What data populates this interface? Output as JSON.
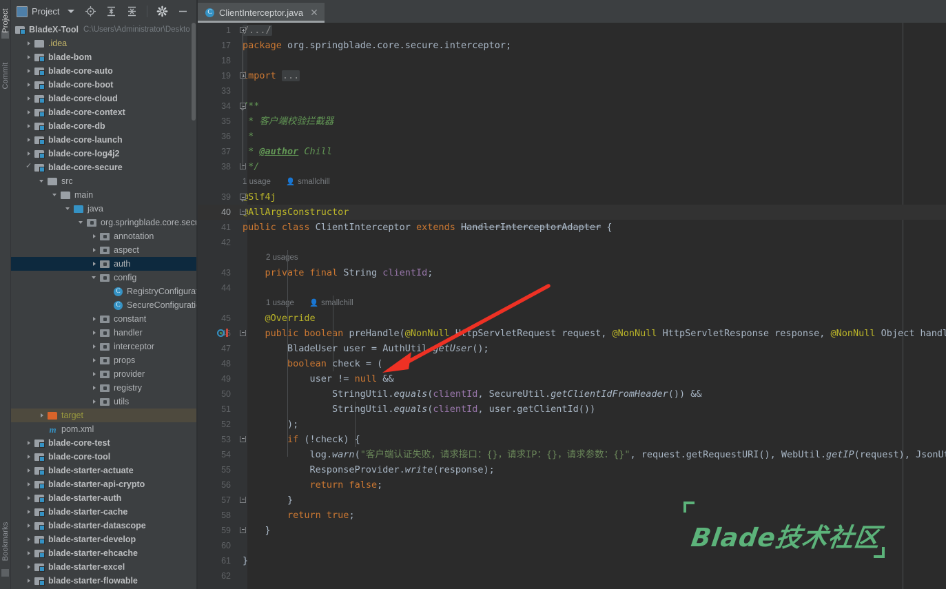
{
  "window": {
    "tool_strip": [
      {
        "label": "Project",
        "name": "tool-tab-project"
      },
      {
        "label": "Commit",
        "name": "tool-tab-commit"
      },
      {
        "label": "Bookmarks",
        "name": "tool-tab-bookmarks"
      }
    ]
  },
  "project_panel": {
    "title": "Project",
    "toolbar": [
      {
        "name": "locate-icon",
        "glyph": "locate"
      },
      {
        "name": "expand-all-icon",
        "glyph": "expand"
      },
      {
        "name": "collapse-all-icon",
        "glyph": "collapse"
      },
      {
        "name": "settings-gear-icon",
        "glyph": "gear"
      },
      {
        "name": "hide-panel-icon",
        "glyph": "minus"
      }
    ],
    "root": {
      "label": "BladeX-Tool",
      "path": "C:\\Users\\Administrator\\Deskto"
    },
    "tree": [
      {
        "label": ".idea",
        "indent": 1,
        "icon": "folder",
        "arrow": "closed",
        "style": "yellowish"
      },
      {
        "label": "blade-bom",
        "indent": 1,
        "icon": "module",
        "arrow": "closed",
        "style": "bold"
      },
      {
        "label": "blade-core-auto",
        "indent": 1,
        "icon": "module",
        "arrow": "closed",
        "style": "bold"
      },
      {
        "label": "blade-core-boot",
        "indent": 1,
        "icon": "module",
        "arrow": "closed",
        "style": "bold"
      },
      {
        "label": "blade-core-cloud",
        "indent": 1,
        "icon": "module",
        "arrow": "closed",
        "style": "bold"
      },
      {
        "label": "blade-core-context",
        "indent": 1,
        "icon": "module",
        "arrow": "closed",
        "style": "bold"
      },
      {
        "label": "blade-core-db",
        "indent": 1,
        "icon": "module",
        "arrow": "closed",
        "style": "bold"
      },
      {
        "label": "blade-core-launch",
        "indent": 1,
        "icon": "module",
        "arrow": "closed",
        "style": "bold"
      },
      {
        "label": "blade-core-log4j2",
        "indent": 1,
        "icon": "module",
        "arrow": "closed",
        "style": "bold"
      },
      {
        "label": "blade-core-secure",
        "indent": 1,
        "icon": "module",
        "arrow": "check",
        "style": "bold"
      },
      {
        "label": "src",
        "indent": 2,
        "icon": "folder",
        "arrow": "open",
        "style": "dim"
      },
      {
        "label": "main",
        "indent": 3,
        "icon": "folder",
        "arrow": "open",
        "style": "dim"
      },
      {
        "label": "java",
        "indent": 4,
        "icon": "folder-blue",
        "arrow": "open",
        "style": "dim"
      },
      {
        "label": "org.springblade.core.secure",
        "indent": 5,
        "icon": "pkg",
        "arrow": "open",
        "style": "dim"
      },
      {
        "label": "annotation",
        "indent": 6,
        "icon": "pkg",
        "arrow": "closed",
        "style": "dim"
      },
      {
        "label": "aspect",
        "indent": 6,
        "icon": "pkg",
        "arrow": "closed",
        "style": "dim"
      },
      {
        "label": "auth",
        "indent": 6,
        "icon": "pkg",
        "arrow": "closed",
        "style": "dim",
        "state": "selected"
      },
      {
        "label": "config",
        "indent": 6,
        "icon": "pkg",
        "arrow": "open",
        "style": "dim"
      },
      {
        "label": "RegistryConfiguration",
        "indent": 7,
        "icon": "class",
        "arrow": "none",
        "style": "dim"
      },
      {
        "label": "SecureConfiguration",
        "indent": 7,
        "icon": "class",
        "arrow": "none",
        "style": "dim"
      },
      {
        "label": "constant",
        "indent": 6,
        "icon": "pkg",
        "arrow": "closed",
        "style": "dim"
      },
      {
        "label": "handler",
        "indent": 6,
        "icon": "pkg",
        "arrow": "closed",
        "style": "dim"
      },
      {
        "label": "interceptor",
        "indent": 6,
        "icon": "pkg",
        "arrow": "closed",
        "style": "dim"
      },
      {
        "label": "props",
        "indent": 6,
        "icon": "pkg",
        "arrow": "closed",
        "style": "dim"
      },
      {
        "label": "provider",
        "indent": 6,
        "icon": "pkg",
        "arrow": "closed",
        "style": "dim"
      },
      {
        "label": "registry",
        "indent": 6,
        "icon": "pkg",
        "arrow": "closed",
        "style": "dim"
      },
      {
        "label": "utils",
        "indent": 6,
        "icon": "pkg",
        "arrow": "closed",
        "style": "dim"
      },
      {
        "label": "target",
        "indent": 2,
        "icon": "folder-orange",
        "arrow": "closed",
        "style": "olive",
        "state": "hovered"
      },
      {
        "label": "pom.xml",
        "indent": 2,
        "icon": "maven",
        "arrow": "none",
        "style": "dim"
      },
      {
        "label": "blade-core-test",
        "indent": 1,
        "icon": "module",
        "arrow": "closed",
        "style": "bold"
      },
      {
        "label": "blade-core-tool",
        "indent": 1,
        "icon": "module",
        "arrow": "closed",
        "style": "bold"
      },
      {
        "label": "blade-starter-actuate",
        "indent": 1,
        "icon": "module",
        "arrow": "closed",
        "style": "bold"
      },
      {
        "label": "blade-starter-api-crypto",
        "indent": 1,
        "icon": "module",
        "arrow": "closed",
        "style": "bold"
      },
      {
        "label": "blade-starter-auth",
        "indent": 1,
        "icon": "module",
        "arrow": "closed",
        "style": "bold"
      },
      {
        "label": "blade-starter-cache",
        "indent": 1,
        "icon": "module",
        "arrow": "closed",
        "style": "bold"
      },
      {
        "label": "blade-starter-datascope",
        "indent": 1,
        "icon": "module",
        "arrow": "closed",
        "style": "bold"
      },
      {
        "label": "blade-starter-develop",
        "indent": 1,
        "icon": "module",
        "arrow": "closed",
        "style": "bold"
      },
      {
        "label": "blade-starter-ehcache",
        "indent": 1,
        "icon": "module",
        "arrow": "closed",
        "style": "bold"
      },
      {
        "label": "blade-starter-excel",
        "indent": 1,
        "icon": "module",
        "arrow": "closed",
        "style": "bold"
      },
      {
        "label": "blade-starter-flowable",
        "indent": 1,
        "icon": "module",
        "arrow": "closed",
        "style": "bold"
      }
    ]
  },
  "editor": {
    "tab": {
      "label": "ClientInterceptor.java",
      "icon": "java-class-icon",
      "close": "✕"
    },
    "current_line": 40,
    "lines": [
      {
        "no": "1",
        "kind": "code",
        "fold": "plus",
        "tokens": [
          {
            "t": "/.../",
            "c": "fold-ph"
          }
        ]
      },
      {
        "no": "17",
        "kind": "code",
        "tokens": [
          {
            "t": "package ",
            "c": "kw"
          },
          {
            "t": "org.springblade.core.secure.interceptor;",
            "c": "id"
          }
        ]
      },
      {
        "no": "18",
        "kind": "code",
        "tokens": []
      },
      {
        "no": "19",
        "kind": "code",
        "fold": "plus",
        "tokens": [
          {
            "t": "import ",
            "c": "kw"
          },
          {
            "t": "...",
            "c": "fold-ph"
          }
        ]
      },
      {
        "no": "33",
        "kind": "code",
        "tokens": []
      },
      {
        "no": "34",
        "kind": "code",
        "fold": "arrowdown",
        "tokens": [
          {
            "t": "/**",
            "c": "cmt"
          }
        ]
      },
      {
        "no": "35",
        "kind": "code",
        "tokens": [
          {
            "t": " * 客户端校验拦截器",
            "c": "cmt"
          }
        ]
      },
      {
        "no": "36",
        "kind": "code",
        "tokens": [
          {
            "t": " *",
            "c": "cmt"
          }
        ]
      },
      {
        "no": "37",
        "kind": "code",
        "tokens": [
          {
            "t": " * ",
            "c": "cmt"
          },
          {
            "t": "@author",
            "c": "cmtl"
          },
          {
            "t": " Chill",
            "c": "cmt"
          }
        ]
      },
      {
        "no": "38",
        "kind": "code",
        "fold": "end",
        "tokens": [
          {
            "t": " */",
            "c": "cmt"
          }
        ]
      },
      {
        "no": "",
        "kind": "hint",
        "usage": "1 usage",
        "author": "smallchill",
        "hint_indent": 0
      },
      {
        "no": "39",
        "kind": "code",
        "fold": "arrowdown",
        "tokens": [
          {
            "t": "@Slf4j",
            "c": "ann"
          }
        ]
      },
      {
        "no": "40",
        "kind": "code",
        "fold": "end",
        "tokens": [
          {
            "t": "@AllArgsConstructor",
            "c": "ann"
          }
        ]
      },
      {
        "no": "41",
        "kind": "code",
        "tokens": [
          {
            "t": "public class ",
            "c": "kw"
          },
          {
            "t": "ClientInterceptor",
            "c": "id"
          },
          {
            "t": " extends ",
            "c": "kw"
          },
          {
            "t": "HandlerInterceptorAdapter",
            "c": "dep"
          },
          {
            "t": " {",
            "c": "id"
          }
        ]
      },
      {
        "no": "42",
        "kind": "code",
        "tokens": []
      },
      {
        "no": "",
        "kind": "hint",
        "usage": "2 usages",
        "author": "",
        "hint_indent": 34
      },
      {
        "no": "43",
        "kind": "code",
        "tokens": [
          {
            "t": "    ",
            "c": "id"
          },
          {
            "t": "private final ",
            "c": "kw"
          },
          {
            "t": "String",
            "c": "id"
          },
          {
            "t": " ",
            "c": "id"
          },
          {
            "t": "clientId",
            "c": "fld"
          },
          {
            "t": ";",
            "c": "id"
          }
        ]
      },
      {
        "no": "44",
        "kind": "code",
        "tokens": []
      },
      {
        "no": "",
        "kind": "hint",
        "usage": "1 usage",
        "author": "smallchill",
        "hint_indent": 34
      },
      {
        "no": "45",
        "kind": "code",
        "tokens": [
          {
            "t": "    ",
            "c": "id"
          },
          {
            "t": "@Override",
            "c": "ann"
          }
        ]
      },
      {
        "no": "46",
        "kind": "code",
        "fold": "end2",
        "gutter_icon": "override-method-icon",
        "tokens": [
          {
            "t": "    ",
            "c": "id"
          },
          {
            "t": "public boolean ",
            "c": "kw"
          },
          {
            "t": "preHandle",
            "c": "id"
          },
          {
            "t": "(",
            "c": "id"
          },
          {
            "t": "@NonNull",
            "c": "ann"
          },
          {
            "t": " HttpServletRequest request, ",
            "c": "id"
          },
          {
            "t": "@NonNull",
            "c": "ann"
          },
          {
            "t": " HttpServletResponse response, ",
            "c": "id"
          },
          {
            "t": "@NonNull",
            "c": "ann"
          },
          {
            "t": " Object handler",
            "c": "id"
          }
        ]
      },
      {
        "no": "47",
        "kind": "code",
        "tokens": [
          {
            "t": "        BladeUser user = AuthUtil.",
            "c": "id"
          },
          {
            "t": "getUser",
            "c": "mth"
          },
          {
            "t": "();",
            "c": "id"
          }
        ]
      },
      {
        "no": "48",
        "kind": "code",
        "tokens": [
          {
            "t": "        ",
            "c": "id"
          },
          {
            "t": "boolean ",
            "c": "kw"
          },
          {
            "t": "check = (",
            "c": "id"
          }
        ]
      },
      {
        "no": "49",
        "kind": "code",
        "tokens": [
          {
            "t": "            user != ",
            "c": "id"
          },
          {
            "t": "null",
            "c": "kw"
          },
          {
            "t": " &&",
            "c": "id"
          }
        ]
      },
      {
        "no": "50",
        "kind": "code",
        "tokens": [
          {
            "t": "                StringUtil.",
            "c": "id"
          },
          {
            "t": "equals",
            "c": "mth"
          },
          {
            "t": "(",
            "c": "id"
          },
          {
            "t": "clientId",
            "c": "fld"
          },
          {
            "t": ", SecureUtil.",
            "c": "id"
          },
          {
            "t": "getClientIdFromHeader",
            "c": "mth"
          },
          {
            "t": "()) &&",
            "c": "id"
          }
        ]
      },
      {
        "no": "51",
        "kind": "code",
        "tokens": [
          {
            "t": "                StringUtil.",
            "c": "id"
          },
          {
            "t": "equals",
            "c": "mth"
          },
          {
            "t": "(",
            "c": "id"
          },
          {
            "t": "clientId",
            "c": "fld"
          },
          {
            "t": ", user.getClientId())",
            "c": "id"
          }
        ]
      },
      {
        "no": "52",
        "kind": "code",
        "tokens": [
          {
            "t": "        );",
            "c": "id"
          }
        ]
      },
      {
        "no": "53",
        "kind": "code",
        "fold": "end3",
        "tokens": [
          {
            "t": "        ",
            "c": "id"
          },
          {
            "t": "if",
            "c": "kw"
          },
          {
            "t": " (!check) {",
            "c": "id"
          }
        ]
      },
      {
        "no": "54",
        "kind": "code",
        "tokens": [
          {
            "t": "            log.",
            "c": "id"
          },
          {
            "t": "warn",
            "c": "mth"
          },
          {
            "t": "(",
            "c": "id"
          },
          {
            "t": "\"客户端认证失败，请求接口：{}，请求IP：{}，请求参数：{}\"",
            "c": "str"
          },
          {
            "t": ", request.getRequestURI(), WebUtil.",
            "c": "id"
          },
          {
            "t": "getIP",
            "c": "mth"
          },
          {
            "t": "(request), JsonUtil",
            "c": "id"
          }
        ]
      },
      {
        "no": "55",
        "kind": "code",
        "tokens": [
          {
            "t": "            ResponseProvider.",
            "c": "id"
          },
          {
            "t": "write",
            "c": "mth"
          },
          {
            "t": "(response);",
            "c": "id"
          }
        ]
      },
      {
        "no": "56",
        "kind": "code",
        "tokens": [
          {
            "t": "            ",
            "c": "id"
          },
          {
            "t": "return false",
            "c": "kw"
          },
          {
            "t": ";",
            "c": "id"
          }
        ]
      },
      {
        "no": "57",
        "kind": "code",
        "fold": "endbrace",
        "tokens": [
          {
            "t": "        }",
            "c": "id"
          }
        ]
      },
      {
        "no": "58",
        "kind": "code",
        "tokens": [
          {
            "t": "        ",
            "c": "id"
          },
          {
            "t": "return true",
            "c": "kw"
          },
          {
            "t": ";",
            "c": "id"
          }
        ]
      },
      {
        "no": "59",
        "kind": "code",
        "fold": "endbrace2",
        "tokens": [
          {
            "t": "    }",
            "c": "id"
          }
        ]
      },
      {
        "no": "60",
        "kind": "code",
        "tokens": []
      },
      {
        "no": "61",
        "kind": "code",
        "tokens": [
          {
            "t": "}",
            "c": "id"
          }
        ]
      },
      {
        "no": "62",
        "kind": "code",
        "tokens": []
      }
    ]
  },
  "watermark": {
    "text": "Blade技术社区",
    "color": "#5cb37a"
  },
  "annotation": {
    "type": "red-arrow",
    "color": "#ee3124"
  },
  "colors": {
    "panel_bg": "#3c3f41",
    "editor_bg": "#2b2b2b",
    "gutter_bg": "#313335",
    "selection": "#0d293e",
    "hover": "#4e4a3e",
    "accent": "#3592c4"
  }
}
